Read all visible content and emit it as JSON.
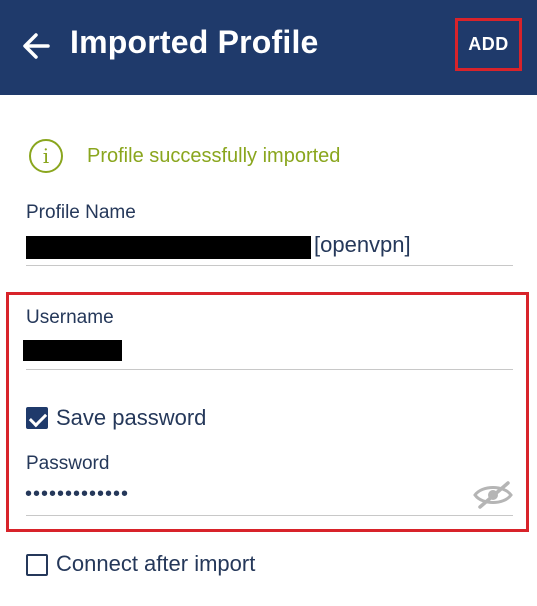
{
  "header": {
    "title": "Imported Profile",
    "add_label": "ADD",
    "back_icon": "arrow-left-icon",
    "background_color": "#1f3a6b"
  },
  "status": {
    "message": "Profile successfully imported",
    "icon": "info-circle-icon",
    "color": "#8aa61e"
  },
  "profile": {
    "label": "Profile Name",
    "value_suffix": "[openvpn]"
  },
  "credentials": {
    "username_label": "Username",
    "save_password_label": "Save password",
    "save_password_checked": true,
    "password_label": "Password",
    "password_value": "•••••••••••••",
    "visibility_icon": "eye-off-icon"
  },
  "options": {
    "connect_after_import_label": "Connect after import",
    "connect_after_import_checked": false
  },
  "highlight_color": "#d8232a"
}
